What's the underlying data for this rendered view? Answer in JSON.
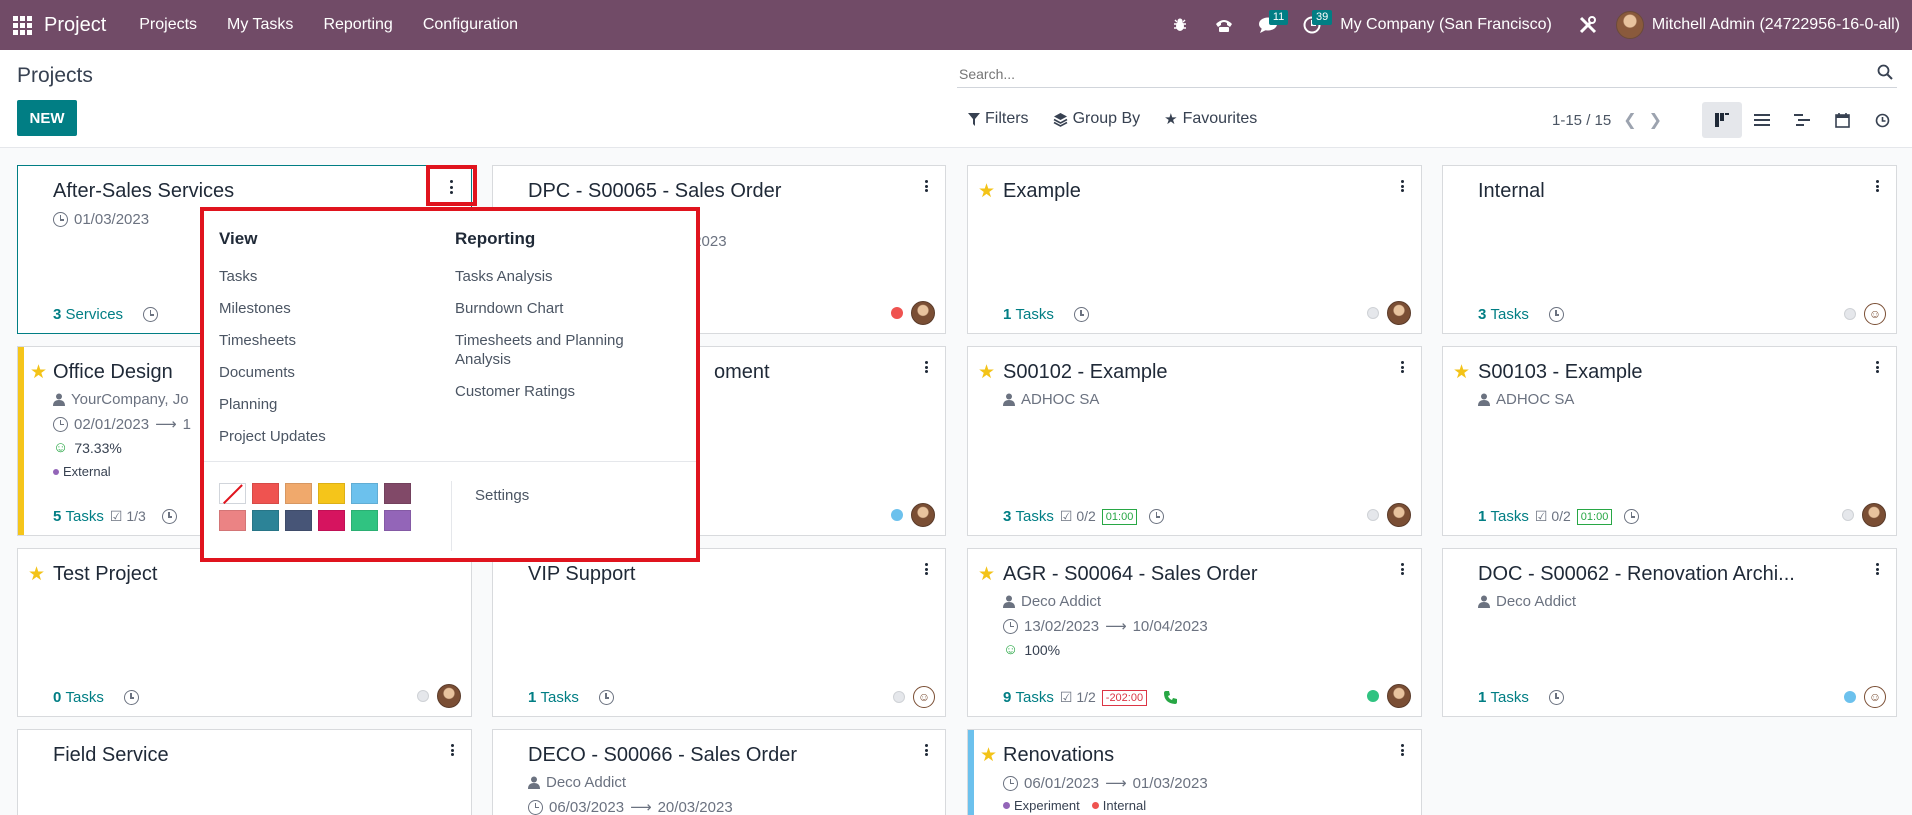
{
  "navbar": {
    "brand": "Project",
    "menu": [
      "Projects",
      "My Tasks",
      "Reporting",
      "Configuration"
    ],
    "messages_count": "11",
    "activities_count": "39",
    "company": "My Company (San Francisco)",
    "user": "Mitchell Admin (24722956-16-0-all)"
  },
  "control": {
    "title": "Projects",
    "new_label": "NEW",
    "search_placeholder": "Search...",
    "filters_label": "Filters",
    "groupby_label": "Group By",
    "favourites_label": "Favourites",
    "pager": "1-15 / 15"
  },
  "cards": [
    {
      "title": "After-Sales Services",
      "date": "01/03/2023",
      "count": "3",
      "count_label": "Services"
    },
    {
      "title": "DPC - S00065 - Sales Order",
      "partial_date": "/2023"
    },
    {
      "title": "Example",
      "count": "1",
      "count_label": "Tasks"
    },
    {
      "title": "Internal",
      "count": "3",
      "count_label": "Tasks"
    },
    {
      "title": "Office Design",
      "customer": "YourCompany, Jo",
      "date_start": "02/01/2023",
      "date_end_partial": "1",
      "progress": "73.33%",
      "tag": "External",
      "count": "5",
      "count_label": "Tasks",
      "milestones": "1/3"
    },
    {
      "title_partial": "oment"
    },
    {
      "title": "S00102 - Example",
      "customer": "ADHOC SA",
      "count": "3",
      "count_label": "Tasks",
      "milestones": "0/2",
      "time": "01:00"
    },
    {
      "title": "S00103 - Example",
      "customer": "ADHOC SA",
      "count": "1",
      "count_label": "Tasks",
      "milestones": "0/2",
      "time": "01:00"
    },
    {
      "title": "Test Project",
      "count": "0",
      "count_label": "Tasks"
    },
    {
      "title": "VIP Support",
      "count": "1",
      "count_label": "Tasks"
    },
    {
      "title": "AGR - S00064 - Sales Order",
      "customer": "Deco Addict",
      "date_start": "13/02/2023",
      "date_end": "10/04/2023",
      "progress": "100%",
      "count": "9",
      "count_label": "Tasks",
      "milestones": "1/2",
      "time": "-202:00"
    },
    {
      "title": "DOC - S00062 - Renovation Archi...",
      "customer": "Deco Addict",
      "count": "1",
      "count_label": "Tasks"
    },
    {
      "title": "Field Service"
    },
    {
      "title": "DECO - S00066 - Sales Order",
      "customer": "Deco Addict",
      "date_start": "06/03/2023",
      "date_end": "20/03/2023"
    },
    {
      "title": "Renovations",
      "date_start": "06/01/2023",
      "date_end": "01/03/2023",
      "tags": [
        "Experiment",
        "Internal"
      ]
    }
  ],
  "dropdown": {
    "view_head": "View",
    "view_items": [
      "Tasks",
      "Milestones",
      "Timesheets",
      "Documents",
      "Planning",
      "Project Updates"
    ],
    "reporting_head": "Reporting",
    "reporting_items": [
      "Tasks Analysis",
      "Burndown Chart",
      "Timesheets and Planning Analysis",
      "Customer Ratings"
    ],
    "settings": "Settings",
    "colors": [
      "none",
      "#ef5350",
      "#f0a96c",
      "#f5c51a",
      "#6cc1ed",
      "#814968",
      "#eb8384",
      "#2c8397",
      "#475577",
      "#d6145f",
      "#30c381",
      "#9365b8"
    ]
  },
  "colors": {
    "brand": "#714b67",
    "accent": "#017e84",
    "highlight": "#e0141e",
    "star": "#f3c318"
  }
}
